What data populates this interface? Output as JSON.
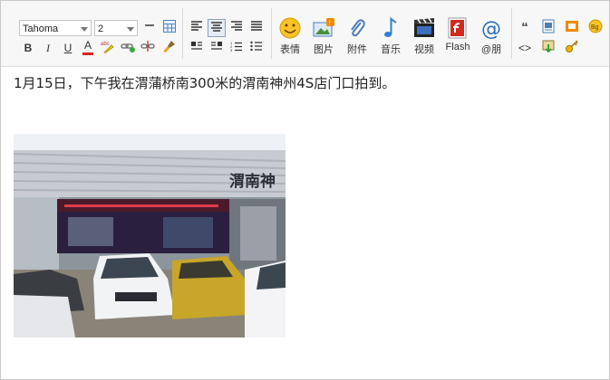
{
  "toolbar": {
    "font_family": "Tahoma",
    "font_size": "2",
    "buttons": {
      "bold": "B",
      "italic": "I",
      "underline": "U",
      "font_color": "A",
      "quote": "“",
      "code": "<>"
    },
    "insert": [
      {
        "label": "表情",
        "icon": "smiley-icon"
      },
      {
        "label": "图片",
        "icon": "image-icon"
      },
      {
        "label": "附件",
        "icon": "paperclip-icon"
      },
      {
        "label": "音乐",
        "icon": "music-note-icon"
      },
      {
        "label": "视频",
        "icon": "video-icon"
      },
      {
        "label": "Flash",
        "icon": "flash-icon"
      },
      {
        "label": "@朋",
        "icon": "at-icon"
      }
    ],
    "colors": {
      "accent": "#2a6cb8",
      "orange": "#f08a00",
      "smiley": "#f7c326"
    }
  },
  "content": {
    "text": "1月15日，下午我在渭蒲桥南300米的渭南神州4S店门口拍到。",
    "photo": {
      "sign_text": "渭南神"
    }
  }
}
